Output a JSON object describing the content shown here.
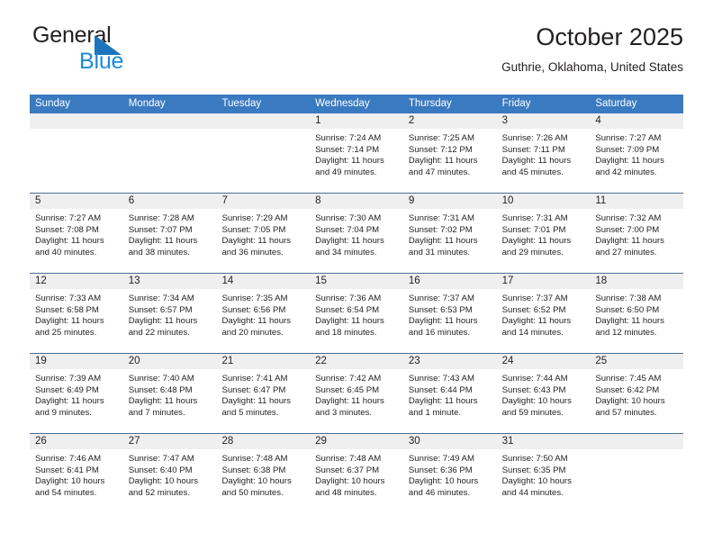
{
  "brand": {
    "name_part1": "General",
    "name_part2": "Blue",
    "triangle_color": "#1b75bb",
    "blue_text_color": "#1b8ad6"
  },
  "header": {
    "title": "October 2025",
    "location": "Guthrie, Oklahoma, United States"
  },
  "theme": {
    "header_blue": "#3a7ac0",
    "row_divider": "#4a6f96",
    "day_band_gray": "#efefef"
  },
  "calendar": {
    "weekday_headers": [
      "Sunday",
      "Monday",
      "Tuesday",
      "Wednesday",
      "Thursday",
      "Friday",
      "Saturday"
    ],
    "weeks": [
      [
        {
          "empty": true,
          "day": ""
        },
        {
          "empty": true,
          "day": ""
        },
        {
          "empty": true,
          "day": ""
        },
        {
          "day": "1",
          "sunrise": "Sunrise: 7:24 AM",
          "sunset": "Sunset: 7:14 PM",
          "daylight": "Daylight: 11 hours and 49 minutes."
        },
        {
          "day": "2",
          "sunrise": "Sunrise: 7:25 AM",
          "sunset": "Sunset: 7:12 PM",
          "daylight": "Daylight: 11 hours and 47 minutes."
        },
        {
          "day": "3",
          "sunrise": "Sunrise: 7:26 AM",
          "sunset": "Sunset: 7:11 PM",
          "daylight": "Daylight: 11 hours and 45 minutes."
        },
        {
          "day": "4",
          "sunrise": "Sunrise: 7:27 AM",
          "sunset": "Sunset: 7:09 PM",
          "daylight": "Daylight: 11 hours and 42 minutes."
        }
      ],
      [
        {
          "day": "5",
          "sunrise": "Sunrise: 7:27 AM",
          "sunset": "Sunset: 7:08 PM",
          "daylight": "Daylight: 11 hours and 40 minutes."
        },
        {
          "day": "6",
          "sunrise": "Sunrise: 7:28 AM",
          "sunset": "Sunset: 7:07 PM",
          "daylight": "Daylight: 11 hours and 38 minutes."
        },
        {
          "day": "7",
          "sunrise": "Sunrise: 7:29 AM",
          "sunset": "Sunset: 7:05 PM",
          "daylight": "Daylight: 11 hours and 36 minutes."
        },
        {
          "day": "8",
          "sunrise": "Sunrise: 7:30 AM",
          "sunset": "Sunset: 7:04 PM",
          "daylight": "Daylight: 11 hours and 34 minutes."
        },
        {
          "day": "9",
          "sunrise": "Sunrise: 7:31 AM",
          "sunset": "Sunset: 7:02 PM",
          "daylight": "Daylight: 11 hours and 31 minutes."
        },
        {
          "day": "10",
          "sunrise": "Sunrise: 7:31 AM",
          "sunset": "Sunset: 7:01 PM",
          "daylight": "Daylight: 11 hours and 29 minutes."
        },
        {
          "day": "11",
          "sunrise": "Sunrise: 7:32 AM",
          "sunset": "Sunset: 7:00 PM",
          "daylight": "Daylight: 11 hours and 27 minutes."
        }
      ],
      [
        {
          "day": "12",
          "sunrise": "Sunrise: 7:33 AM",
          "sunset": "Sunset: 6:58 PM",
          "daylight": "Daylight: 11 hours and 25 minutes."
        },
        {
          "day": "13",
          "sunrise": "Sunrise: 7:34 AM",
          "sunset": "Sunset: 6:57 PM",
          "daylight": "Daylight: 11 hours and 22 minutes."
        },
        {
          "day": "14",
          "sunrise": "Sunrise: 7:35 AM",
          "sunset": "Sunset: 6:56 PM",
          "daylight": "Daylight: 11 hours and 20 minutes."
        },
        {
          "day": "15",
          "sunrise": "Sunrise: 7:36 AM",
          "sunset": "Sunset: 6:54 PM",
          "daylight": "Daylight: 11 hours and 18 minutes."
        },
        {
          "day": "16",
          "sunrise": "Sunrise: 7:37 AM",
          "sunset": "Sunset: 6:53 PM",
          "daylight": "Daylight: 11 hours and 16 minutes."
        },
        {
          "day": "17",
          "sunrise": "Sunrise: 7:37 AM",
          "sunset": "Sunset: 6:52 PM",
          "daylight": "Daylight: 11 hours and 14 minutes."
        },
        {
          "day": "18",
          "sunrise": "Sunrise: 7:38 AM",
          "sunset": "Sunset: 6:50 PM",
          "daylight": "Daylight: 11 hours and 12 minutes."
        }
      ],
      [
        {
          "day": "19",
          "sunrise": "Sunrise: 7:39 AM",
          "sunset": "Sunset: 6:49 PM",
          "daylight": "Daylight: 11 hours and 9 minutes."
        },
        {
          "day": "20",
          "sunrise": "Sunrise: 7:40 AM",
          "sunset": "Sunset: 6:48 PM",
          "daylight": "Daylight: 11 hours and 7 minutes."
        },
        {
          "day": "21",
          "sunrise": "Sunrise: 7:41 AM",
          "sunset": "Sunset: 6:47 PM",
          "daylight": "Daylight: 11 hours and 5 minutes."
        },
        {
          "day": "22",
          "sunrise": "Sunrise: 7:42 AM",
          "sunset": "Sunset: 6:45 PM",
          "daylight": "Daylight: 11 hours and 3 minutes."
        },
        {
          "day": "23",
          "sunrise": "Sunrise: 7:43 AM",
          "sunset": "Sunset: 6:44 PM",
          "daylight": "Daylight: 11 hours and 1 minute."
        },
        {
          "day": "24",
          "sunrise": "Sunrise: 7:44 AM",
          "sunset": "Sunset: 6:43 PM",
          "daylight": "Daylight: 10 hours and 59 minutes."
        },
        {
          "day": "25",
          "sunrise": "Sunrise: 7:45 AM",
          "sunset": "Sunset: 6:42 PM",
          "daylight": "Daylight: 10 hours and 57 minutes."
        }
      ],
      [
        {
          "day": "26",
          "sunrise": "Sunrise: 7:46 AM",
          "sunset": "Sunset: 6:41 PM",
          "daylight": "Daylight: 10 hours and 54 minutes."
        },
        {
          "day": "27",
          "sunrise": "Sunrise: 7:47 AM",
          "sunset": "Sunset: 6:40 PM",
          "daylight": "Daylight: 10 hours and 52 minutes."
        },
        {
          "day": "28",
          "sunrise": "Sunrise: 7:48 AM",
          "sunset": "Sunset: 6:38 PM",
          "daylight": "Daylight: 10 hours and 50 minutes."
        },
        {
          "day": "29",
          "sunrise": "Sunrise: 7:48 AM",
          "sunset": "Sunset: 6:37 PM",
          "daylight": "Daylight: 10 hours and 48 minutes."
        },
        {
          "day": "30",
          "sunrise": "Sunrise: 7:49 AM",
          "sunset": "Sunset: 6:36 PM",
          "daylight": "Daylight: 10 hours and 46 minutes."
        },
        {
          "day": "31",
          "sunrise": "Sunrise: 7:50 AM",
          "sunset": "Sunset: 6:35 PM",
          "daylight": "Daylight: 10 hours and 44 minutes."
        },
        {
          "empty": true,
          "day": ""
        }
      ]
    ]
  }
}
